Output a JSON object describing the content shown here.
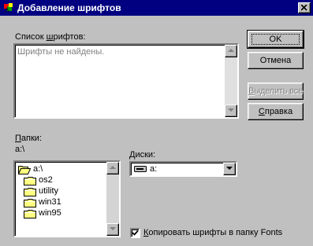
{
  "window": {
    "title": "Добавление шрифтов"
  },
  "fonts": {
    "label_prefix": "Список ",
    "label_underlined": "ш",
    "label_suffix": "рифтов:",
    "empty_text": "Шрифты не найдены."
  },
  "buttons": {
    "ok": "OK",
    "cancel": "Отмена",
    "select_all_underlined": "В",
    "select_all_rest": "ыделить все",
    "help_underlined": "С",
    "help_rest": "правка"
  },
  "folders": {
    "label_underlined": "П",
    "label_rest": "апки:",
    "current_path": "a:\\",
    "items": [
      {
        "name": "a:\\",
        "icon": "open-folder-icon"
      },
      {
        "name": "os2",
        "icon": "folder-icon"
      },
      {
        "name": "utility",
        "icon": "folder-icon"
      },
      {
        "name": "win31",
        "icon": "folder-icon"
      },
      {
        "name": "win95",
        "icon": "folder-icon"
      }
    ]
  },
  "drives": {
    "label_underlined": "Д",
    "label_rest": "иски:",
    "selected": "a:",
    "icon": "floppy-drive-icon"
  },
  "copy_option": {
    "checked": true,
    "label_underlined": "К",
    "label_rest": "опировать шрифты в папку Fonts"
  },
  "colors": {
    "titlebar": "#000080",
    "face": "#c0c0c0",
    "disabled_text": "#808080",
    "folder_yellow": "#ffff80"
  }
}
